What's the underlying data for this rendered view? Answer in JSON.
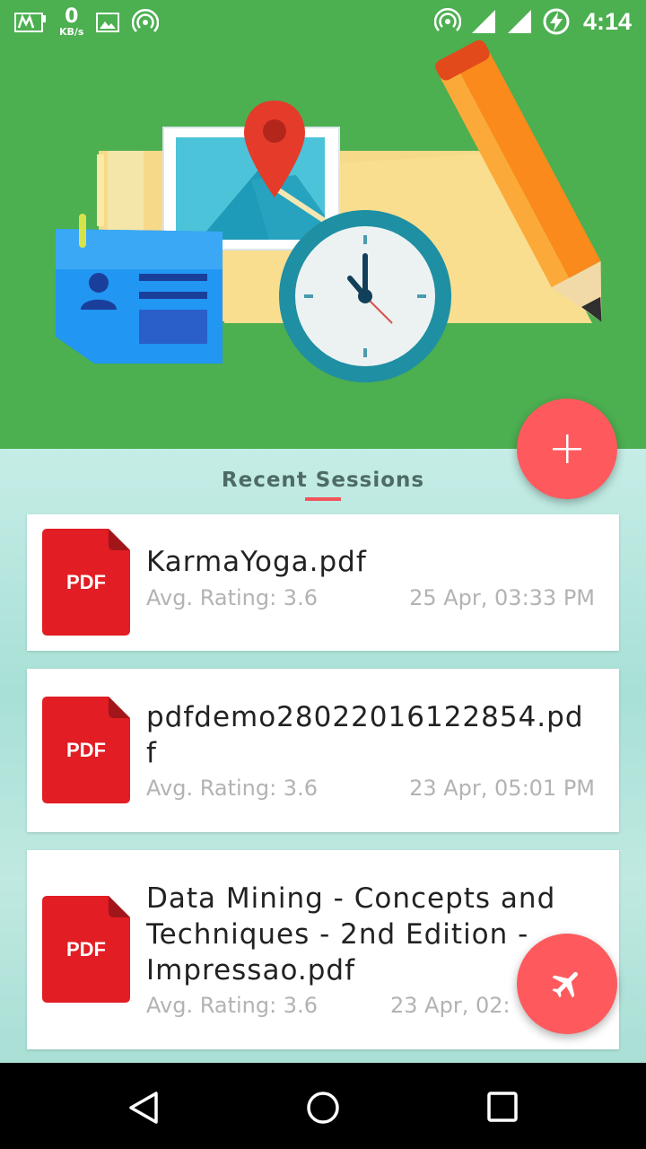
{
  "status_bar": {
    "speed_value": "0",
    "speed_unit": "KB/s",
    "time": "4:14"
  },
  "section": {
    "title": "Recent Sessions"
  },
  "sessions": [
    {
      "name": "KarmaYoga.pdf",
      "rating": "Avg. Rating: 3.6",
      "date": "25 Apr, 03:33 PM",
      "icon_label": "PDF"
    },
    {
      "name": "pdfdemo28022016122854.pdf",
      "rating": "Avg. Rating: 3.6",
      "date": "23 Apr, 05:01 PM",
      "icon_label": "PDF"
    },
    {
      "name": "Data Mining - Concepts and Techniques - 2nd Edition - Impressao.pdf",
      "rating": "Avg. Rating: 3.6",
      "date": "23 Apr, 02:",
      "icon_label": "PDF"
    }
  ],
  "colors": {
    "header_green": "#4caf50",
    "fab_red": "#fe5a5e",
    "pdf_red": "#e21d24",
    "accent_underline": "#f0555a"
  }
}
